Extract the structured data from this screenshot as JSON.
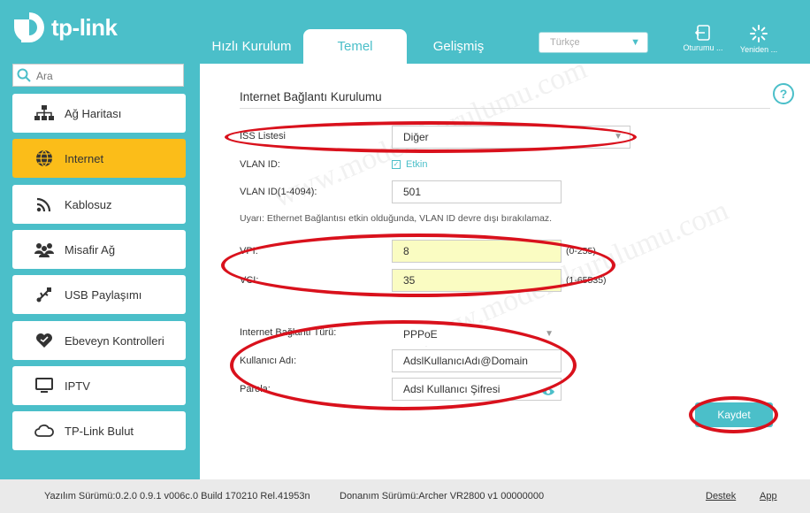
{
  "brand": "tp-link",
  "tabs": [
    {
      "label": "Hızlı Kurulum"
    },
    {
      "label": "Temel"
    },
    {
      "label": "Gelişmiş"
    }
  ],
  "language": {
    "selected": "Türkçe"
  },
  "header_buttons": {
    "logout": "Oturumu ...",
    "reboot": "Yeniden ..."
  },
  "search": {
    "placeholder": "Ara"
  },
  "sidebar": {
    "items": [
      {
        "label": "Ağ Haritası",
        "icon": "network-map-icon"
      },
      {
        "label": "Internet",
        "icon": "globe-icon"
      },
      {
        "label": "Kablosuz",
        "icon": "wireless-icon"
      },
      {
        "label": "Misafir Ağ",
        "icon": "guest-network-icon"
      },
      {
        "label": "USB Paylaşımı",
        "icon": "usb-icon"
      },
      {
        "label": "Ebeveyn Kontrolleri",
        "icon": "heart-icon"
      },
      {
        "label": "IPTV",
        "icon": "tv-icon"
      },
      {
        "label": "TP-Link Bulut",
        "icon": "cloud-icon"
      }
    ]
  },
  "main": {
    "title": "Internet Bağlantı Kurulumu",
    "isp_label": "ISS Listesi",
    "isp_value": "Diğer",
    "vlan_label": "VLAN ID:",
    "vlan_enable": "Etkin",
    "vlan_id_label": "VLAN ID(1-4094):",
    "vlan_id_value": "501",
    "warning": "Uyarı: Ethernet Bağlantısı etkin olduğunda, VLAN ID devre dışı bırakılamaz.",
    "vpi_label": "VPI:",
    "vpi_value": "8",
    "vpi_range": "(0-255)",
    "vci_label": "VCI:",
    "vci_value": "35",
    "vci_range": "(1-65535)",
    "conn_type_label": "Internet Bağlantı Türü:",
    "conn_type_value": "PPPoE",
    "username_label": "Kullanıcı Adı:",
    "username_value": "AdslKullanıcıAdı@Domain",
    "password_label": "Parola:",
    "password_value": "Adsl Kullanıcı Şifresi",
    "save_label": "Kaydet"
  },
  "footer": {
    "firmware": "Yazılım Sürümü:0.2.0 0.9.1 v006c.0 Build 170210 Rel.41953n",
    "hardware": "Donanım Sürümü:Archer VR2800 v1 00000000",
    "support": "Destek",
    "app": "App"
  },
  "watermark": "www.modemkurulumu.com",
  "colors": {
    "accent": "#4bbfc9",
    "active_nav": "#fbbd19",
    "highlight": "#d9111c",
    "yellow_field": "#fafcc2"
  }
}
